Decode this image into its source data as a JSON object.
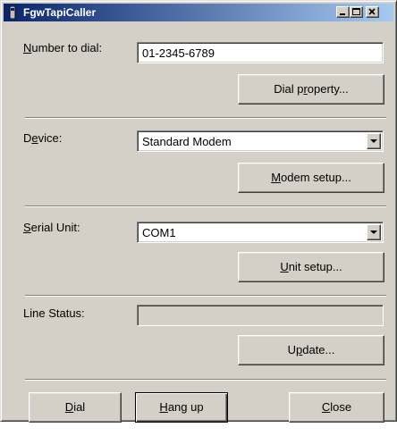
{
  "window": {
    "title": "FgwTapiCaller"
  },
  "number": {
    "label_pre": "",
    "label_u": "N",
    "label_post": "umber to dial:",
    "value": "01-2345-6789"
  },
  "dial_property": {
    "pre": "Dial p",
    "u": "r",
    "post": "operty..."
  },
  "device": {
    "label_pre": "D",
    "label_u": "e",
    "label_post": "vice:",
    "value": "Standard Modem"
  },
  "modem_setup": {
    "pre": "",
    "u": "M",
    "post": "odem setup..."
  },
  "serial": {
    "label_pre": "",
    "label_u": "S",
    "label_post": "erial Unit:",
    "value": "COM1"
  },
  "unit_setup": {
    "pre": "",
    "u": "U",
    "post": "nit setup..."
  },
  "line_status": {
    "label": "Line Status:",
    "value": ""
  },
  "update": {
    "pre": "U",
    "u": "p",
    "post": "date..."
  },
  "footer": {
    "dial": {
      "pre": "",
      "u": "D",
      "post": "ial"
    },
    "hangup": {
      "pre": "",
      "u": "H",
      "post": "ang up"
    },
    "close": {
      "pre": "",
      "u": "C",
      "post": "lose"
    }
  },
  "colors": {
    "face": "#d4d0c8",
    "title_start": "#0a246a",
    "title_end": "#a6caf0"
  }
}
